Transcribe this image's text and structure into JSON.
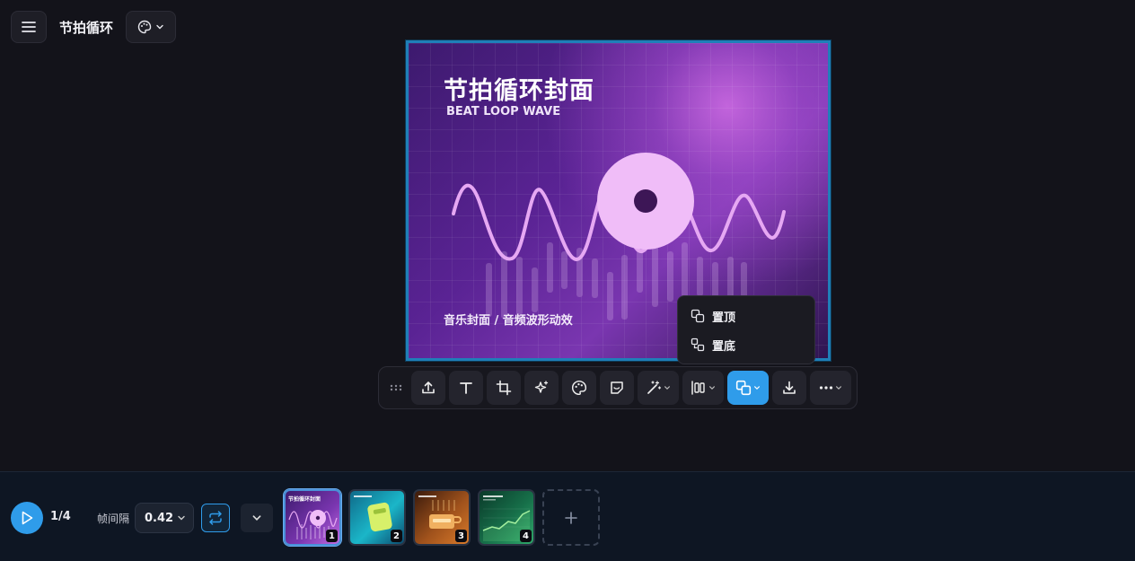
{
  "app": {
    "title": "节拍循环"
  },
  "canvas": {
    "title": "节拍循环封面",
    "subtitle": "BEAT LOOP WAVE",
    "caption": "音乐封面 / 音频波形动效"
  },
  "context_menu": {
    "items": [
      "置顶",
      "置底"
    ]
  },
  "toolbar": {
    "buttons": [
      "drag-handle-icon",
      "upload-icon",
      "text-icon",
      "crop-icon",
      "sparkle-icon",
      "palette-icon",
      "sticker-icon",
      "magic-wand-icon",
      "align-icon",
      "layer-icon",
      "download-icon",
      "more-icon"
    ]
  },
  "player": {
    "page_indicator": "1/4",
    "interval_label": "帧间隔",
    "interval_value": "0.42"
  },
  "thumbnails": [
    {
      "number": "1",
      "title": "节拍循环封面"
    },
    {
      "number": "2",
      "title": ""
    },
    {
      "number": "3",
      "title": ""
    },
    {
      "number": "4",
      "title": ""
    }
  ],
  "colors": {
    "accent": "#2f9cea",
    "background": "#13131a"
  }
}
